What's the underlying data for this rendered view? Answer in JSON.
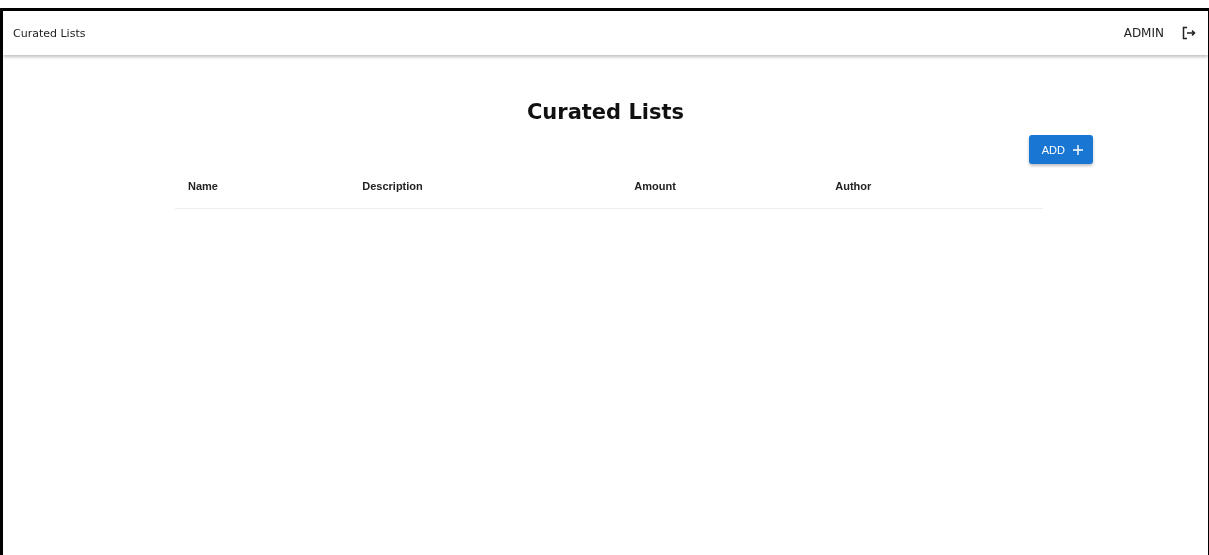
{
  "app_bar": {
    "title": "Curated Lists",
    "user": "ADMIN"
  },
  "page": {
    "heading": "Curated Lists",
    "add_button": "ADD"
  },
  "table": {
    "columns": [
      "Name",
      "Description",
      "Amount",
      "Author"
    ]
  }
}
